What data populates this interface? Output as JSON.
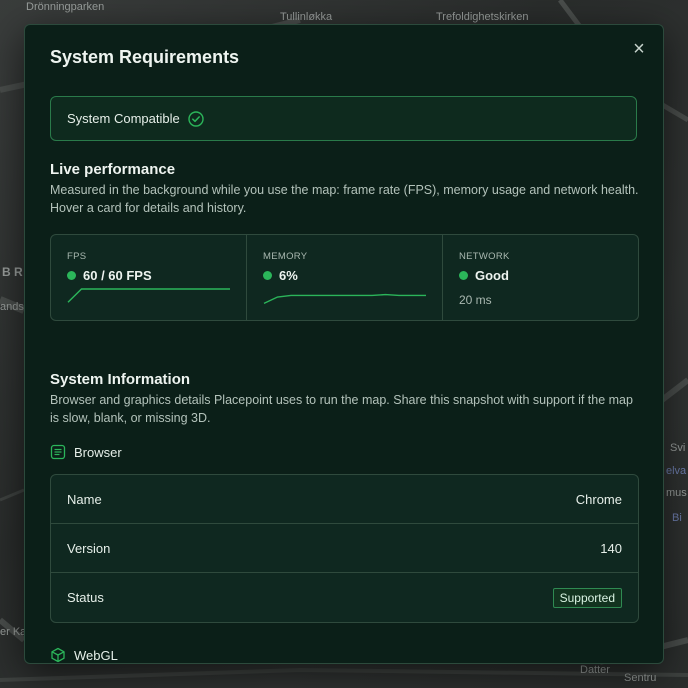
{
  "map": {
    "labels": [
      "Drönningparken",
      "Tullinløkka",
      "Trefoldighetskirken",
      "B R",
      "ands",
      "Svi",
      "elva",
      "mus",
      "Bi",
      "er Ka",
      "Datter",
      "Sentru"
    ]
  },
  "dialog": {
    "title": "System Requirements",
    "close_symbol": "×",
    "compatibility": {
      "text": "System Compatible"
    },
    "live_performance": {
      "title": "Live performance",
      "description": "Measured in the background while you use the map: frame rate (FPS), memory usage and network health. Hover a card for details and history.",
      "cards": [
        {
          "label": "FPS",
          "value": "60 / 60 FPS",
          "history": [
            10,
            60,
            60,
            60,
            60,
            60,
            60,
            60,
            60,
            60,
            60,
            60,
            60
          ]
        },
        {
          "label": "MEMORY",
          "value": "6%",
          "history": [
            1,
            5,
            6,
            6,
            6,
            6,
            6,
            6,
            6,
            6.5,
            6,
            6,
            6
          ]
        },
        {
          "label": "NETWORK",
          "value": "Good",
          "sub": "20 ms"
        }
      ]
    },
    "system_information": {
      "title": "System Information",
      "description": "Browser and graphics details Placepoint uses to run the map. Share this snapshot with support if the map is slow, blank, or missing 3D.",
      "browser": {
        "heading": "Browser",
        "rows": [
          {
            "key": "Name",
            "value": "Chrome"
          },
          {
            "key": "Version",
            "value": "140"
          },
          {
            "key": "Status",
            "value": "Supported"
          }
        ]
      },
      "webgl": {
        "heading": "WebGL"
      }
    }
  },
  "colors": {
    "accent": "#2bb55a",
    "modal_bg": "#0b1f18",
    "card_bg": "#0f2820",
    "border": "#2f4a3d"
  }
}
